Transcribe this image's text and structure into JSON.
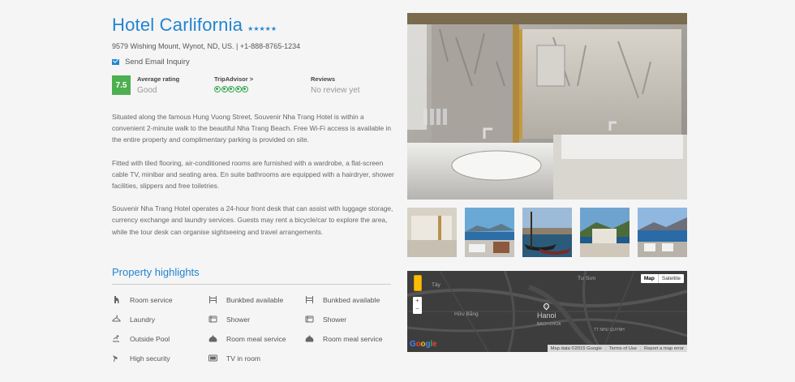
{
  "hotel": {
    "name": "Hotel Carlifornia",
    "stars": "★★★★★",
    "address": "9579 Wishing Mount, Wynot, ND, US. | +1-888-8765-1234",
    "email_inquiry": "Send Email Inquiry"
  },
  "ratings": {
    "score": "7.5",
    "average_label": "Average rating",
    "average_value": "Good",
    "tripadvisor_label": "TripAdvisor >",
    "tripadvisor_bubbles": 5,
    "reviews_label": "Reviews",
    "reviews_value": "No review yet"
  },
  "description": [
    "Situated along the famous Hung Vuong Street, Souvenir Nha Trang Hotel is within a convenient 2-minute walk to the beautiful Nha Trang Beach. Free Wi-Fi access is available in the entire property and complimentary parking is provided on site.",
    "Fitted with tiled flooring, air-conditioned rooms are furnished with a wardrobe, a flat-screen cable TV, minibar and seating area. En suite bathrooms are equipped with a hairdryer, shower facilities, slippers and free toiletries.",
    "Souvenir Nha Trang Hotel operates a 24-hour front desk that can assist with luggage storage, currency exchange and laundry services. Guests may rent a bicycle/car to explore the area, while the tour desk can organise sightseeing and travel arrangements."
  ],
  "highlights": {
    "title": "Property highlights",
    "items": [
      {
        "label": "Room service",
        "icon": "room-service-icon"
      },
      {
        "label": "Bunkbed available",
        "icon": "bunkbed-icon"
      },
      {
        "label": "Bunkbed available",
        "icon": "bunkbed-icon"
      },
      {
        "label": "Laundry",
        "icon": "laundry-icon"
      },
      {
        "label": "Shower",
        "icon": "shower-icon"
      },
      {
        "label": "Shower",
        "icon": "shower-icon"
      },
      {
        "label": "Outside Pool",
        "icon": "pool-icon"
      },
      {
        "label": "Room meal service",
        "icon": "room-meal-icon"
      },
      {
        "label": "Room meal service",
        "icon": "room-meal-icon"
      },
      {
        "label": "High security",
        "icon": "security-icon"
      },
      {
        "label": "TV in room",
        "icon": "tv-icon"
      }
    ]
  },
  "map": {
    "type_map": "Map",
    "type_satellite": "Satellite",
    "city": "Hanoi",
    "labels": [
      "Tây",
      "Tư Sơn",
      "Hữu Bằng",
      "BACH KHOA",
      "TT NHU QUYNH"
    ],
    "footer": [
      "Map data ©2015 Google",
      "Terms of Use",
      "Report a map error"
    ],
    "zoom_in": "+",
    "zoom_out": "−",
    "logo": [
      "G",
      "o",
      "o",
      "g",
      "l",
      "e"
    ]
  },
  "colors": {
    "accent": "#2185d0",
    "score_bg": "#4caf50",
    "tripadvisor": "#34a853"
  }
}
